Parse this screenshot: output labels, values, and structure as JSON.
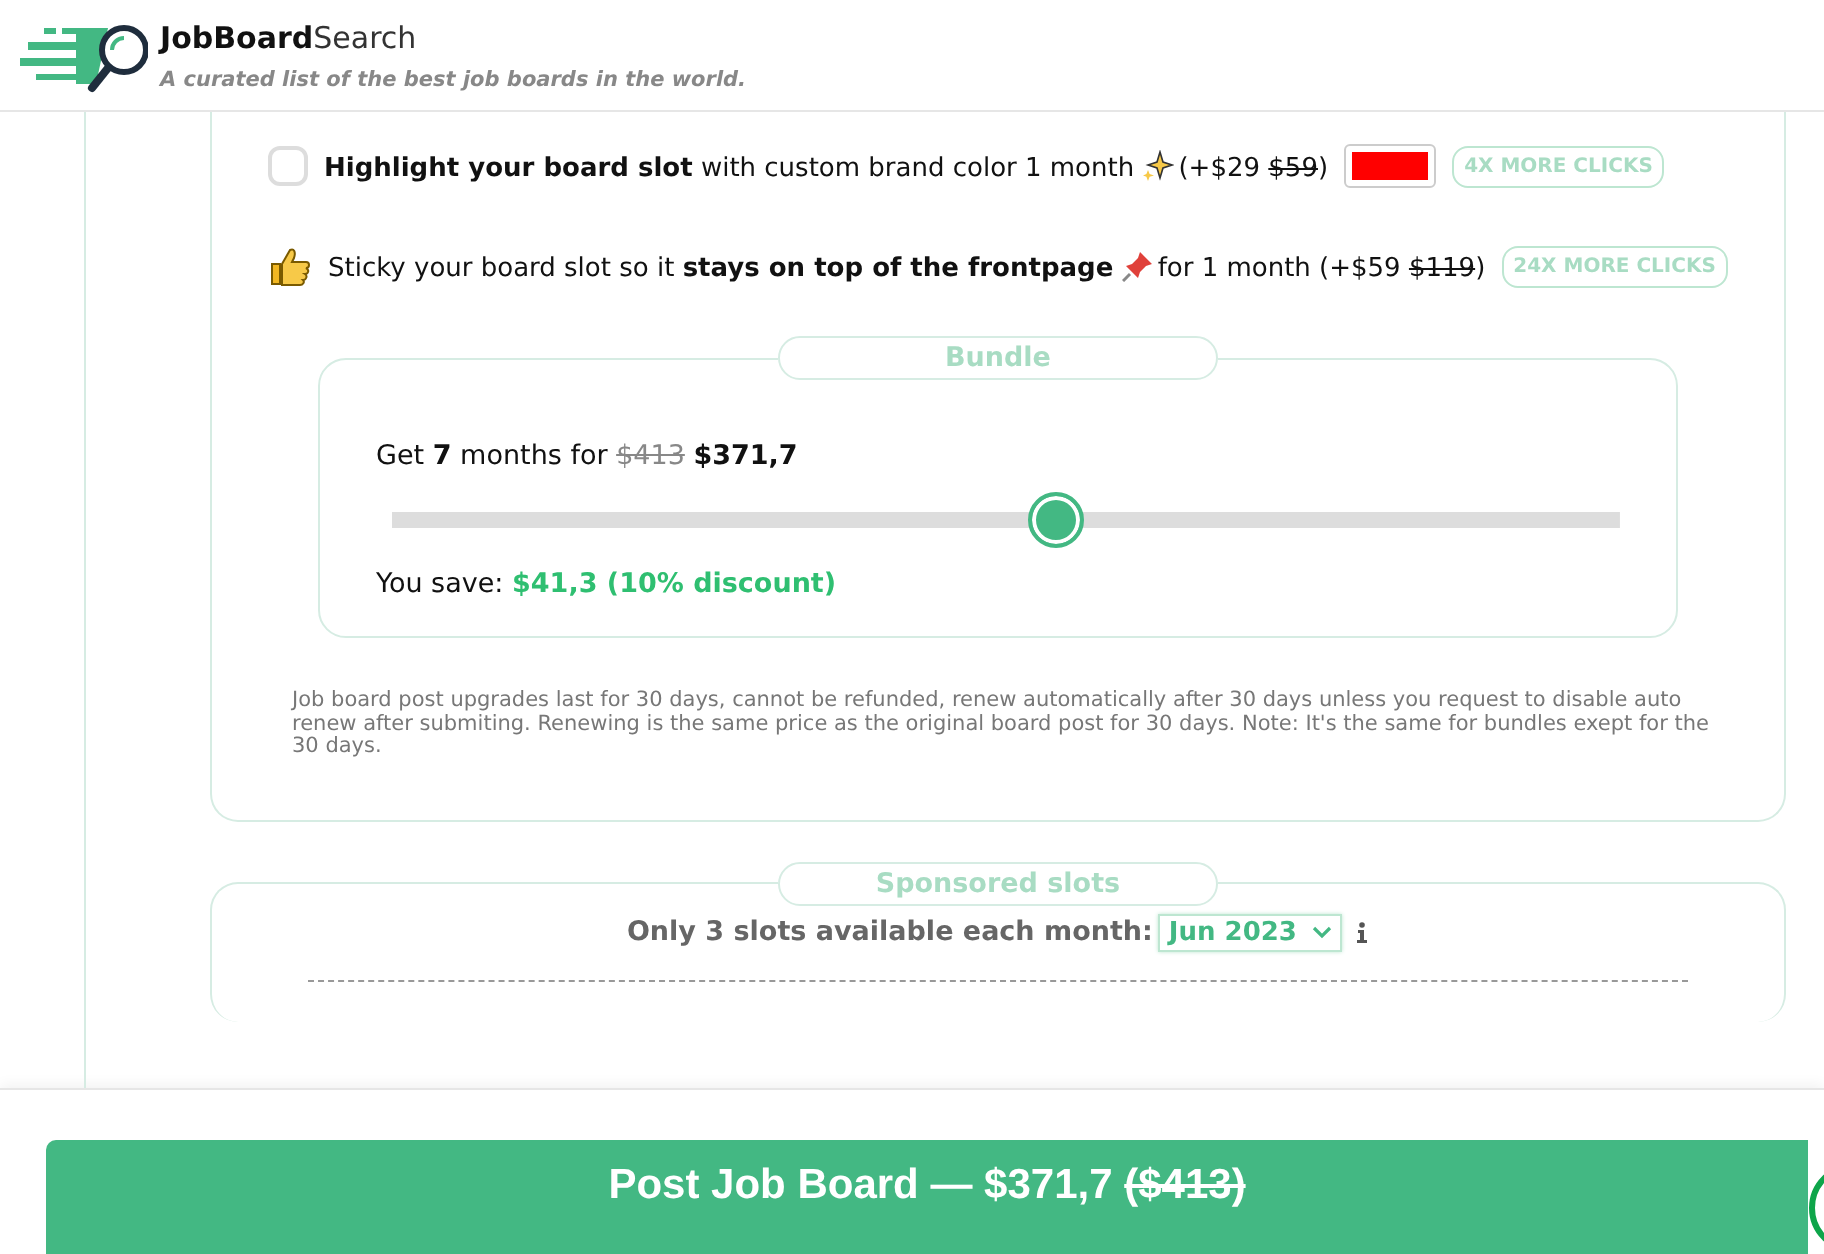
{
  "header": {
    "brand_bold": "JobBoard",
    "brand_light": "Search",
    "tagline": "A curated list of the best job boards in the world."
  },
  "upgrades": [
    {
      "kind": "checkbox",
      "checked": false,
      "prefix": "**Highlight your board slot** with custom brand color 1 month",
      "after_icon": "(+$29",
      "old_price": "$59",
      "suffix": ")",
      "color": "#ff0000",
      "badge": "4X MORE CLICKS"
    },
    {
      "kind": "thumb",
      "prefix": "Sticky your board slot so it **stays on top of the frontpage**",
      "after_icon": "for 1 month (+$59",
      "old_price": "$119",
      "suffix": ")",
      "badge": "24X MORE CLICKS"
    }
  ],
  "bundle": {
    "legend": "Bundle",
    "offer_prefix": "Get **7** months for",
    "old_price": "$413",
    "price": "$371,7",
    "level": 0.54,
    "save_label": "You save:",
    "save_value": "$41,3 (10% discount)"
  },
  "note": "Job board post upgrades last for 30 days, cannot be refunded, renew automatically after 30 days unless you request to disable auto renew after submiting. Renewing is the same price as the original board post for 30 days. Note: It's the same for bundles exept for the 30 days.",
  "sponsored": {
    "legend": "Sponsored slots",
    "label": "Only 3 slots available each month:",
    "month": "Jun 2023"
  },
  "post_button": {
    "label": "Post Job Board — $371,7",
    "old_price": "($413)"
  }
}
